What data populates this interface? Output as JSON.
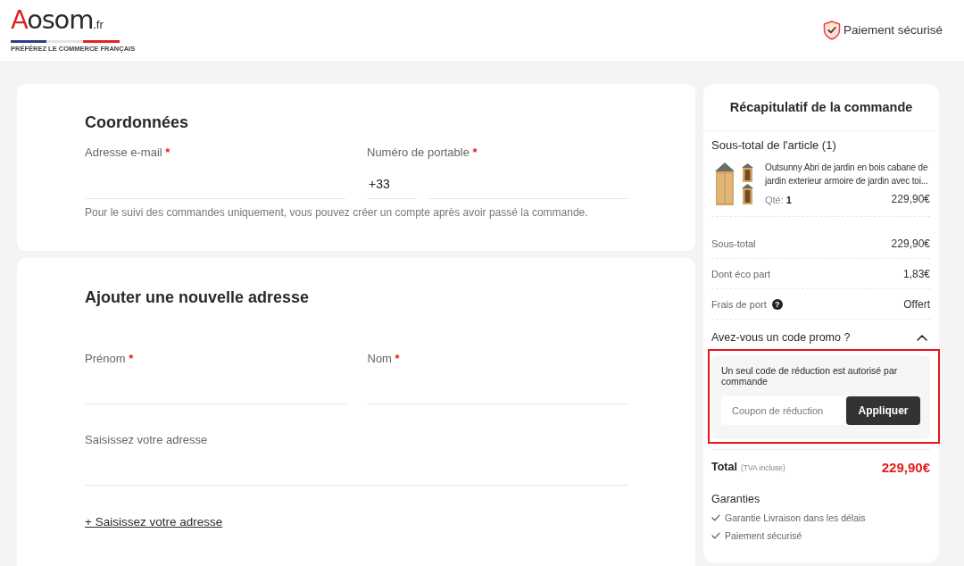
{
  "header": {
    "logo": {
      "initial": "A",
      "word": "osom",
      "suffix": ".fr",
      "tagline": "PRÉFÉREZ LE COMMERCE FRANÇAIS"
    },
    "secure_badge": "Paiement sécurisé"
  },
  "contact": {
    "title": "Coordonnées",
    "fields": [
      {
        "kind": "email",
        "label": "Adresse e-mail",
        "required_mark": "*"
      },
      {
        "kind": "phone",
        "label": "Numéro de portable",
        "required_mark": "*",
        "prefix": "+33"
      }
    ],
    "hint": "Pour le suivi des commandes uniquement, vous pouvez créer un compte après avoir passé la commande."
  },
  "address": {
    "title": "Ajouter une nouvelle adresse",
    "rows": [
      {
        "fields": [
          {
            "kind": "text",
            "label": "Prénom",
            "required_mark": "*"
          },
          {
            "kind": "text",
            "label": "Nom",
            "required_mark": "*"
          }
        ]
      },
      {
        "fields": [
          {
            "kind": "text",
            "label": "Saisissez votre adresse"
          }
        ]
      }
    ],
    "link": "+ Saisissez votre adresse"
  },
  "summary": {
    "title": "Récapitulatif de la commande",
    "items_heading": "Sous-total de l'article (1)",
    "items": [
      {
        "name": "Outsunny Abri de jardin en bois cabane de jardin exterieur armoire de jardin avec toi...",
        "qty": "Qté: **1**",
        "price": "229,90€"
      }
    ],
    "rows": [
      {
        "kind": "plain",
        "label": "Sous-total",
        "value": "229,90€"
      },
      {
        "kind": "plain",
        "label": "Dont éco part",
        "value": "1,83€"
      },
      {
        "kind": "help",
        "label": "Frais de port",
        "help_icon": "?",
        "value": "Offert"
      }
    ],
    "promo": {
      "title": "Avez-vous un code promo ?",
      "expanded": true,
      "highlighted": true,
      "note": "Un seul code de réduction est autorisé par commande",
      "placeholder": "Coupon de réduction",
      "button": "Appliquer"
    },
    "total": {
      "label": "Total",
      "note": "(TVA incluse)",
      "value": "229,90€"
    },
    "guarantees": {
      "title": "Garanties",
      "items": [
        "Garantie Livraison dans les délais",
        "Paiement sécurisé"
      ]
    }
  }
}
